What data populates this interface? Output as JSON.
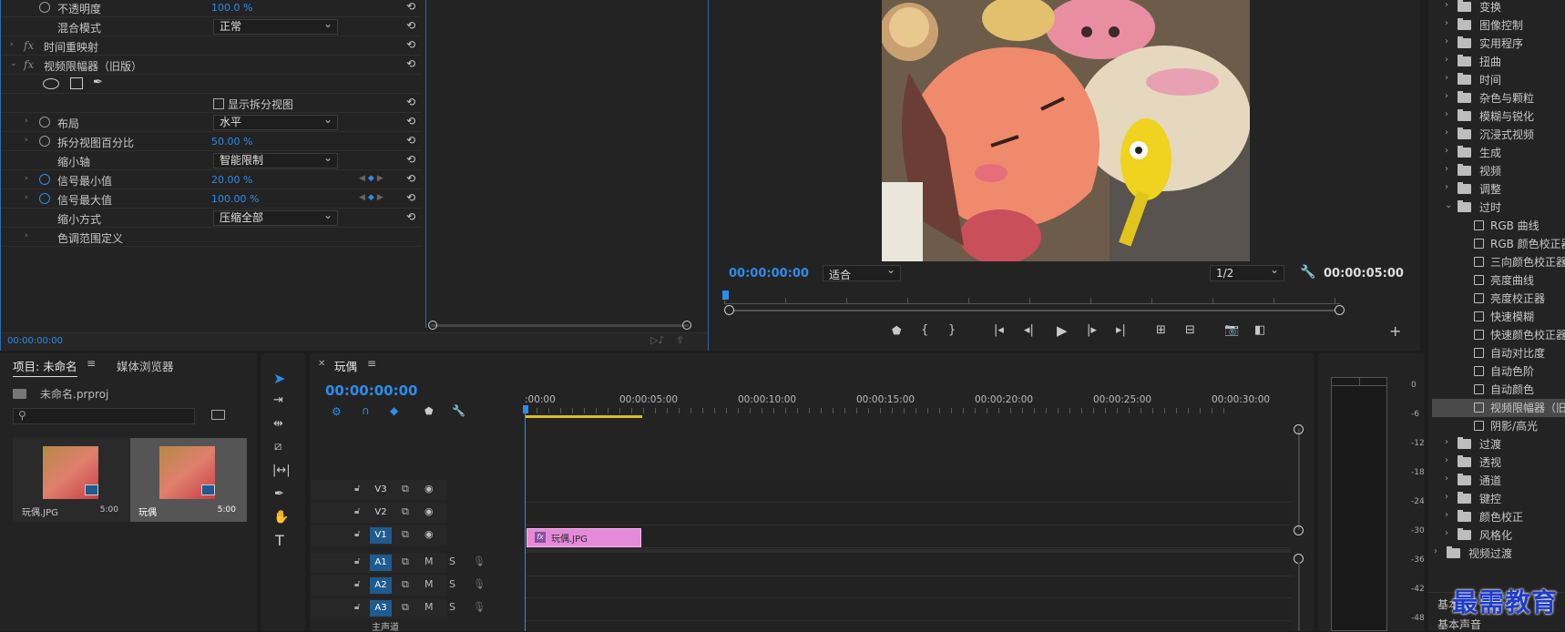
{
  "effect_controls": {
    "rows": [
      {
        "label": "不透明度",
        "value": "100.0 %",
        "type": "value",
        "icon": "stopwatch"
      },
      {
        "label": "混合模式",
        "value": "正常",
        "type": "dropdown"
      },
      {
        "label": "时间重映射",
        "type": "fx-header"
      },
      {
        "label": "视频限幅器（旧版）",
        "type": "fx-header",
        "expanded": true
      },
      {
        "label": "",
        "type": "shapes"
      },
      {
        "label": "显示拆分视图",
        "type": "checkbox"
      },
      {
        "label": "布局",
        "value": "水平",
        "type": "dropdown",
        "icon": "stopwatch"
      },
      {
        "label": "拆分视图百分比",
        "value": "50.00 %",
        "type": "value",
        "icon": "stopwatch"
      },
      {
        "label": "缩小轴",
        "value": "智能限制",
        "type": "dropdown"
      },
      {
        "label": "信号最小值",
        "value": "20.00 %",
        "type": "value",
        "icon": "stopwatch-on"
      },
      {
        "label": "信号最大值",
        "value": "100.00 %",
        "type": "value",
        "icon": "stopwatch-on"
      },
      {
        "label": "缩小方式",
        "value": "压缩全部",
        "type": "dropdown"
      },
      {
        "label": "色调范围定义",
        "type": "group"
      }
    ],
    "timecode": "00:00:00:00"
  },
  "program_monitor": {
    "timecode_left": "00:00:00:00",
    "fit_label": "适合",
    "resolution": "1/2",
    "timecode_right": "00:00:05:00",
    "colors": {
      "accent": "#2d8ceb"
    }
  },
  "project": {
    "tabs": [
      "项目: 未命名",
      "媒体浏览器"
    ],
    "filename": "未命名.prproj",
    "items": [
      {
        "name": "玩偶.JPG",
        "duration": "5:00"
      },
      {
        "name": "玩偶",
        "duration": "5:00"
      }
    ]
  },
  "timeline": {
    "sequence": "玩偶",
    "timecode": "00:00:00:00",
    "ruler": [
      ":00:00",
      "00:00:05:00",
      "00:00:10:00",
      "00:00:15:00",
      "00:00:20:00",
      "00:00:25:00",
      "00:00:30:00"
    ],
    "tracks_video": [
      "V3",
      "V2",
      "V1"
    ],
    "tracks_audio": [
      "A1",
      "A2",
      "A3"
    ],
    "clip_name": "玩偶.JPG",
    "clip_fx": "fx",
    "master": "主声道",
    "m": "M",
    "s": "S"
  },
  "effects_panel": {
    "items": [
      {
        "label": "变换",
        "level": 0
      },
      {
        "label": "图像控制",
        "level": 0
      },
      {
        "label": "实用程序",
        "level": 0
      },
      {
        "label": "扭曲",
        "level": 0
      },
      {
        "label": "时间",
        "level": 0
      },
      {
        "label": "杂色与颗粒",
        "level": 0
      },
      {
        "label": "模糊与锐化",
        "level": 0
      },
      {
        "label": "沉浸式视频",
        "level": 0
      },
      {
        "label": "生成",
        "level": 0
      },
      {
        "label": "视频",
        "level": 0
      },
      {
        "label": "调整",
        "level": 0
      },
      {
        "label": "过时",
        "level": 0,
        "expanded": true
      },
      {
        "label": "RGB 曲线",
        "level": 1
      },
      {
        "label": "RGB 颜色校正器",
        "level": 1
      },
      {
        "label": "三向颜色校正器",
        "level": 1
      },
      {
        "label": "亮度曲线",
        "level": 1
      },
      {
        "label": "亮度校正器",
        "level": 1
      },
      {
        "label": "快速模糊",
        "level": 1
      },
      {
        "label": "快速颜色校正器",
        "level": 1
      },
      {
        "label": "自动对比度",
        "level": 1
      },
      {
        "label": "自动色阶",
        "level": 1
      },
      {
        "label": "自动颜色",
        "level": 1
      },
      {
        "label": "视频限幅器（旧版）",
        "level": 1,
        "selected": true
      },
      {
        "label": "阴影/高光",
        "level": 1
      },
      {
        "label": "过渡",
        "level": 0
      },
      {
        "label": "透视",
        "level": 0
      },
      {
        "label": "通道",
        "level": 0
      },
      {
        "label": "键控",
        "level": 0
      },
      {
        "label": "颜色校正",
        "level": 0
      },
      {
        "label": "风格化",
        "level": 0
      },
      {
        "label": "视频过渡",
        "level": -1
      }
    ],
    "bottom1": "基本",
    "bottom2": "基本声音"
  },
  "meter": {
    "labels": [
      "0",
      "-6",
      "-12",
      "-18",
      "-24",
      "-30",
      "-36",
      "-42",
      "-48"
    ]
  },
  "watermark": "最需教育"
}
